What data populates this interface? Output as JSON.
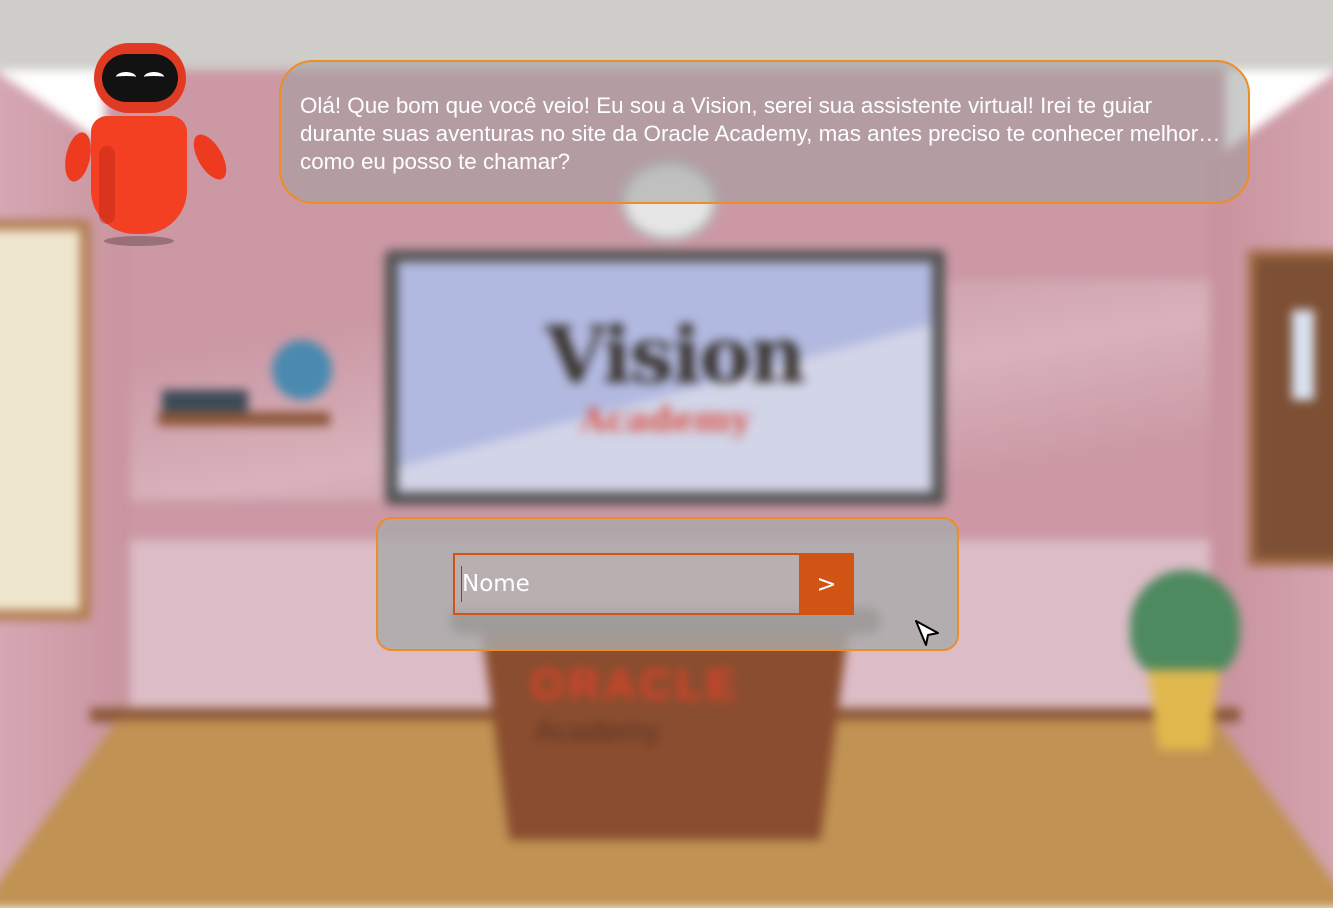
{
  "dialog": {
    "message": "Olá! Que bom que você veio! Eu sou a Vision, serei sua assistente virtual! Irei te guiar durante suas aventuras no site da Oracle Academy, mas antes preciso te conhecer melhor… como eu posso te chamar?"
  },
  "name_form": {
    "placeholder": "Nome",
    "submit_label": ">"
  },
  "background": {
    "board_logo": "Vision",
    "board_logo_sub": "Academy",
    "desk_logo": "ORACLE",
    "desk_logo_sub": "Academy"
  },
  "colors": {
    "accent_border": "#ec8d27",
    "button": "#d25414",
    "robot": "#f33f22"
  },
  "icons": {
    "assistant": "robot-icon",
    "cursor": "mouse-pointer-icon"
  }
}
